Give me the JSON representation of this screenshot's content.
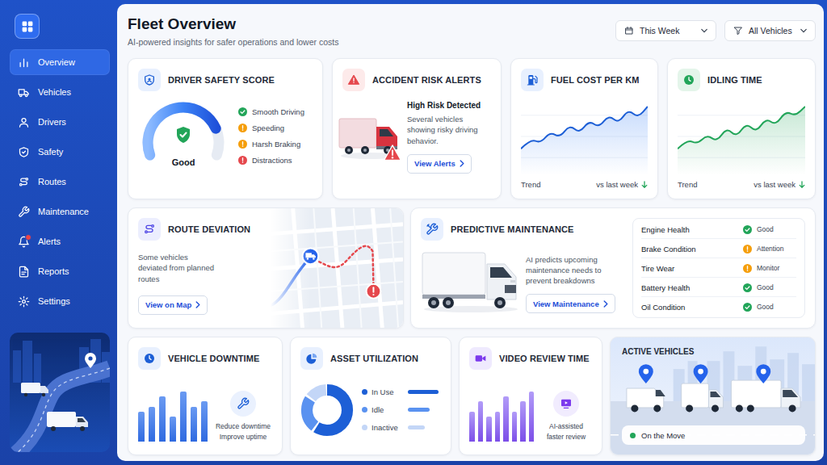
{
  "sidebar": {
    "items": [
      {
        "label": "Overview",
        "selected": true,
        "badge": false
      },
      {
        "label": "Vehicles",
        "selected": false,
        "badge": false
      },
      {
        "label": "Drivers",
        "selected": false,
        "badge": false
      },
      {
        "label": "Safety",
        "selected": false,
        "badge": false
      },
      {
        "label": "Routes",
        "selected": false,
        "badge": false
      },
      {
        "label": "Maintenance",
        "selected": false,
        "badge": false
      },
      {
        "label": "Alerts",
        "selected": false,
        "badge": true
      },
      {
        "label": "Reports",
        "selected": false,
        "badge": false
      },
      {
        "label": "Settings",
        "selected": false,
        "badge": false
      }
    ]
  },
  "header": {
    "title": "Fleet Overview",
    "subtitle": "AI-powered insights for safer operations and lower costs",
    "filters": [
      {
        "label": "This Week"
      },
      {
        "label": "All Vehicles"
      }
    ]
  },
  "safety_score": {
    "title": "DRIVER SAFETY SCORE",
    "rating": "Good",
    "level": 0.8,
    "legend": [
      {
        "label": "Smooth Driving",
        "kind": "check",
        "color": "#22a559"
      },
      {
        "label": "Speeding",
        "kind": "alert",
        "color": "#f59e0b"
      },
      {
        "label": "Harsh Braking",
        "kind": "alert",
        "color": "#f59e0b"
      },
      {
        "label": "Distractions",
        "kind": "alert",
        "color": "#e5484d"
      }
    ]
  },
  "accident_alerts": {
    "title": "ACCIDENT RISK ALERTS",
    "heading": "High Risk Detected",
    "text": "Several vehicles showing risky driving behavior.",
    "button": "View Alerts"
  },
  "fuel_cost": {
    "title": "FUEL COST PER KM",
    "series": [
      38,
      45,
      42,
      50,
      46,
      55,
      49,
      58,
      53,
      62,
      56,
      66,
      60,
      68
    ],
    "trend_label": "Trend",
    "compare_label": "vs last week"
  },
  "idling_time": {
    "title": "IDLING TIME",
    "series": [
      30,
      38,
      34,
      42,
      36,
      48,
      40,
      52,
      44,
      56,
      50,
      62,
      58,
      66
    ],
    "trend_label": "Trend",
    "compare_label": "vs last week"
  },
  "route_deviation": {
    "title": "ROUTE DEVIATION",
    "text": "Some vehicles deviated from planned routes",
    "button": "View on Map"
  },
  "predictive_maintenance": {
    "title": "PREDICTIVE MAINTENANCE",
    "text": "AI predicts upcoming maintenance needs to prevent breakdowns",
    "button": "View Maintenance",
    "items": [
      {
        "label": "Engine Health",
        "status": "Good",
        "kind": "check",
        "color": "#22a559"
      },
      {
        "label": "Brake Condition",
        "status": "Attention",
        "kind": "alert",
        "color": "#f59e0b"
      },
      {
        "label": "Tire Wear",
        "status": "Monitor",
        "kind": "alert",
        "color": "#f59e0b"
      },
      {
        "label": "Battery Health",
        "status": "Good",
        "kind": "check",
        "color": "#22a559"
      },
      {
        "label": "Oil Condition",
        "status": "Good",
        "kind": "check",
        "color": "#22a559"
      }
    ]
  },
  "vehicle_downtime": {
    "title": "VEHICLE DOWNTIME",
    "bars": [
      6,
      7,
      9,
      5,
      10,
      7,
      8
    ],
    "notes": [
      "Reduce downtime",
      "Improve uptime"
    ]
  },
  "asset_utilization": {
    "title": "ASSET UTILIZATION",
    "segments": [
      {
        "label": "In Use",
        "share": 60,
        "level": 1,
        "color": "#1d5fd6"
      },
      {
        "label": "Idle",
        "share": 25,
        "level": 0.72,
        "color": "#5a92f0"
      },
      {
        "label": "Inactive",
        "share": 15,
        "level": 0.55,
        "color": "#c3d6f7"
      }
    ]
  },
  "video_review": {
    "title": "VIDEO REVIEW TIME",
    "bars": [
      6,
      8,
      5,
      6,
      9,
      6,
      8,
      10
    ],
    "notes": [
      "AI-assisted",
      "faster review"
    ]
  },
  "active_vehicles": {
    "title": "ACTIVE VEHICLES",
    "status": "On the Move"
  }
}
